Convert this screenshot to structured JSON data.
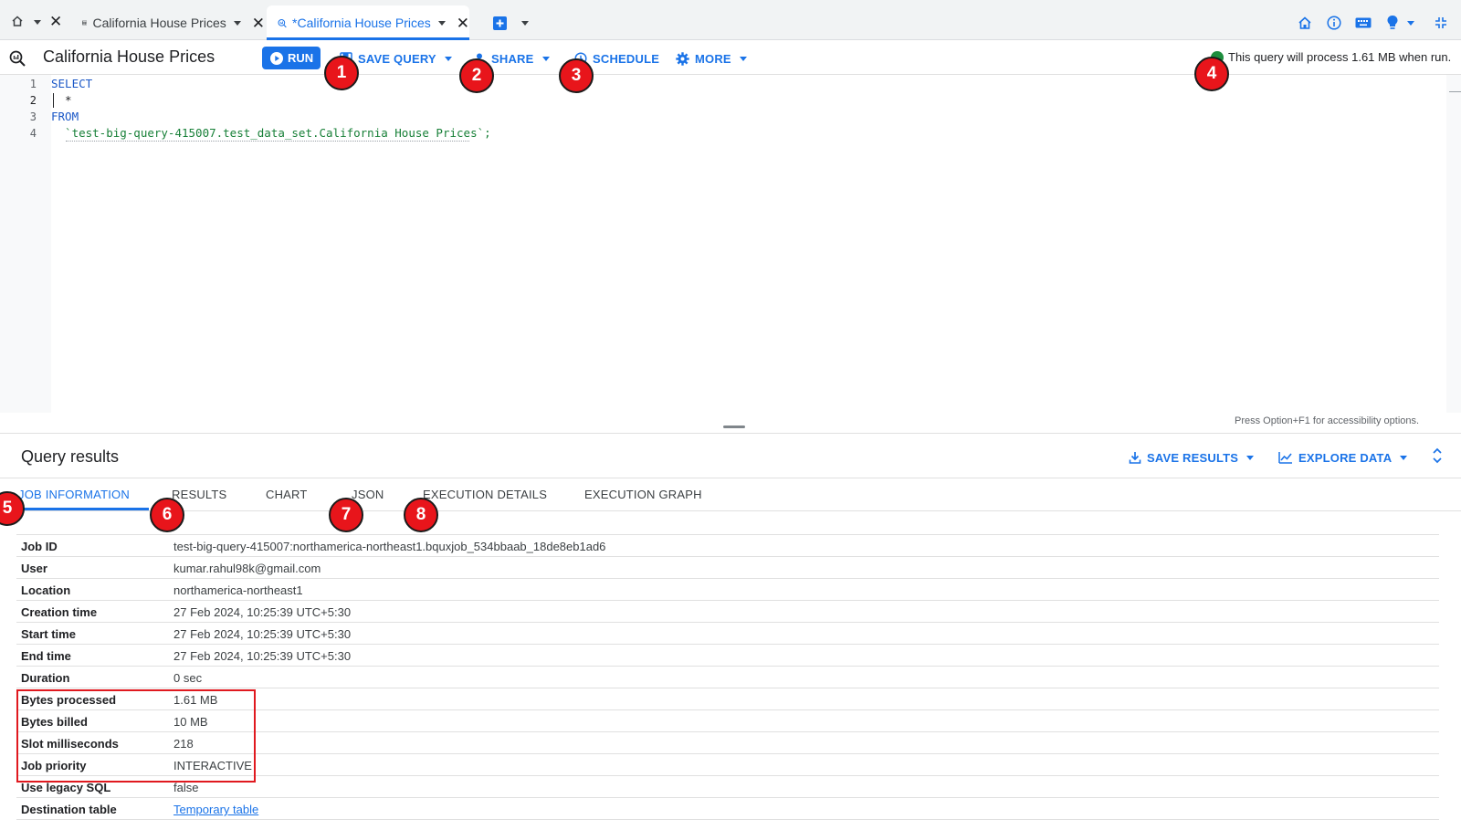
{
  "tabs": [
    {
      "label": "California House Prices"
    },
    {
      "label": "*California House Prices"
    }
  ],
  "toolbar": {
    "title": "California House Prices",
    "run": "RUN",
    "save_query": "SAVE QUERY",
    "share": "SHARE",
    "schedule": "SCHEDULE",
    "more": "MORE",
    "estimate": "This query will process 1.61 MB when run."
  },
  "editor": {
    "line_numbers": [
      "1",
      "2",
      "3",
      "4"
    ],
    "lines": [
      "SELECT",
      "  *",
      "FROM",
      "  `test-big-query-415007.test_data_set.California House Prices`;"
    ],
    "accessibility_hint": "Press Option+F1 for accessibility options."
  },
  "results": {
    "title": "Query results",
    "save_results": "SAVE RESULTS",
    "explore_data": "EXPLORE DATA",
    "tabs": [
      "JOB INFORMATION",
      "RESULTS",
      "CHART",
      "JSON",
      "EXECUTION DETAILS",
      "EXECUTION GRAPH"
    ],
    "rows": [
      {
        "key": "Job ID",
        "value": "test-big-query-415007:northamerica-northeast1.bquxjob_534bbaab_18de8eb1ad6"
      },
      {
        "key": "User",
        "value": "kumar.rahul98k@gmail.com"
      },
      {
        "key": "Location",
        "value": "northamerica-northeast1"
      },
      {
        "key": "Creation time",
        "value": "27 Feb 2024, 10:25:39 UTC+5:30"
      },
      {
        "key": "Start time",
        "value": "27 Feb 2024, 10:25:39 UTC+5:30"
      },
      {
        "key": "End time",
        "value": "27 Feb 2024, 10:25:39 UTC+5:30"
      },
      {
        "key": "Duration",
        "value": "0 sec"
      },
      {
        "key": "Bytes processed",
        "value": "1.61 MB"
      },
      {
        "key": "Bytes billed",
        "value": "10 MB"
      },
      {
        "key": "Slot milliseconds",
        "value": "218"
      },
      {
        "key": "Job priority",
        "value": "INTERACTIVE"
      },
      {
        "key": "Use legacy SQL",
        "value": "false"
      },
      {
        "key": "Destination table",
        "value": "Temporary table"
      }
    ]
  },
  "annotations": [
    "1",
    "2",
    "3",
    "4",
    "5",
    "6",
    "7",
    "8"
  ],
  "colors": {
    "accent": "#1a73e8",
    "annotation": "#e8151b",
    "highlight_box": "#e0191f",
    "sql_keyword": "#1a57c7",
    "sql_string": "#188038"
  }
}
